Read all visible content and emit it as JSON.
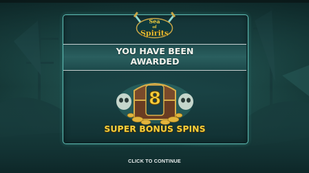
{
  "topbar": {
    "label": ""
  },
  "logo": {
    "line1": "Sea",
    "line2": "of",
    "line3": "Spirits"
  },
  "dialog": {
    "heading_line1": "YOU HAVE BEEN",
    "heading_line2": "AWARDED",
    "spin_count": "8",
    "spins_label": "SUPER BONUS SPINS"
  },
  "continue_label": "CLICK TO CONTINUE",
  "colors": {
    "accent_gold": "#f5cf3c",
    "panel_border": "#5fbdb5",
    "background": "#1c4745"
  },
  "icons": [
    "skull-icon",
    "treasure-chest-icon",
    "crossed-swords-icon",
    "gold-coin-icon"
  ]
}
